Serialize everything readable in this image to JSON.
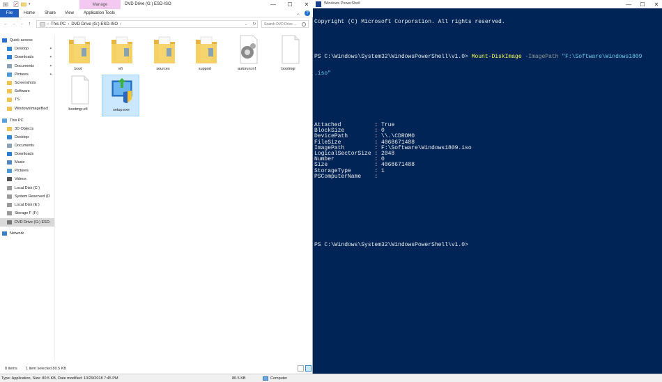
{
  "explorer": {
    "title": "DVD Drive (G:) ESD-ISO",
    "manage_tab": "Manage",
    "ribbon_tabs": [
      "File",
      "Home",
      "Share",
      "View",
      "Application Tools"
    ],
    "address": [
      "This PC",
      "DVD Drive (G:) ESD-ISO"
    ],
    "search_placeholder": "Search DVD Drive ...",
    "nav": [
      {
        "label": "Quick access",
        "icon": "star-icon"
      },
      {
        "label": "Desktop",
        "icon": "desktop-icon"
      },
      {
        "label": "Downloads",
        "icon": "download-icon"
      },
      {
        "label": "Documents",
        "icon": "documents-icon"
      },
      {
        "label": "Pictures",
        "icon": "pictures-icon"
      },
      {
        "label": "Screenshots",
        "icon": "folder-icon"
      },
      {
        "label": "Software",
        "icon": "folder-icon"
      },
      {
        "label": "TS",
        "icon": "folder-icon"
      },
      {
        "label": "WindowsImageBacl",
        "icon": "folder-icon"
      },
      {
        "label": "This PC",
        "icon": "computer-icon"
      },
      {
        "label": "3D Objects",
        "icon": "folder-icon"
      },
      {
        "label": "Desktop",
        "icon": "desktop-icon"
      },
      {
        "label": "Documents",
        "icon": "documents-icon"
      },
      {
        "label": "Downloads",
        "icon": "download-icon"
      },
      {
        "label": "Music",
        "icon": "music-icon"
      },
      {
        "label": "Pictures",
        "icon": "pictures-icon"
      },
      {
        "label": "Videos",
        "icon": "videos-icon"
      },
      {
        "label": "Local Disk (C:)",
        "icon": "drive-icon"
      },
      {
        "label": "System Reserved (D",
        "icon": "drive-icon"
      },
      {
        "label": "Local Disk (E:)",
        "icon": "drive-icon"
      },
      {
        "label": "Storage F (F:)",
        "icon": "drive-icon"
      },
      {
        "label": "DVD Drive (G:) ESD-",
        "icon": "dvd-icon"
      },
      {
        "label": "Network",
        "icon": "network-icon"
      }
    ],
    "files": [
      {
        "name": "boot",
        "kind": "folder"
      },
      {
        "name": "efi",
        "kind": "folder"
      },
      {
        "name": "sources",
        "kind": "folder"
      },
      {
        "name": "support",
        "kind": "folder"
      },
      {
        "name": "autorun.inf",
        "kind": "inf"
      },
      {
        "name": "bootmgr",
        "kind": "file"
      },
      {
        "name": "bootmgr.efi",
        "kind": "file"
      },
      {
        "name": "setup.exe",
        "kind": "setup"
      }
    ],
    "status_items": "8 items",
    "status_selected": "1 item selected  80.5 KB",
    "details": "Type: Application, Size: 80.5 KB, Date modified: 10/29/2018 7:45 PM",
    "details_size": "80.5 KB",
    "details_location": "Computer"
  },
  "powershell": {
    "title": "Windows PowerShell",
    "copyright": "Copyright (C) Microsoft Corporation. All rights reserved.",
    "prompt": "PS C:\\Windows\\System32\\WindowsPowerShell\\v1.0> ",
    "command": "Mount-DiskImage",
    "param": " -ImagePath ",
    "arg_line1": "\"F:\\Software\\Windows1809",
    "arg_line2": ".iso\"",
    "output": [
      "Attached          : True",
      "BlockSize         : 0",
      "DevicePath        : \\\\.\\CDROM0",
      "FileSize          : 4068671488",
      "ImagePath         : F:\\Software\\Windows1809.iso",
      "LogicalSectorSize : 2048",
      "Number            : 0",
      "Size              : 4068671488",
      "StorageType       : 1",
      "PSComputerName    :"
    ],
    "final_prompt": "PS C:\\Windows\\System32\\WindowsPowerShell\\v1.0>"
  }
}
